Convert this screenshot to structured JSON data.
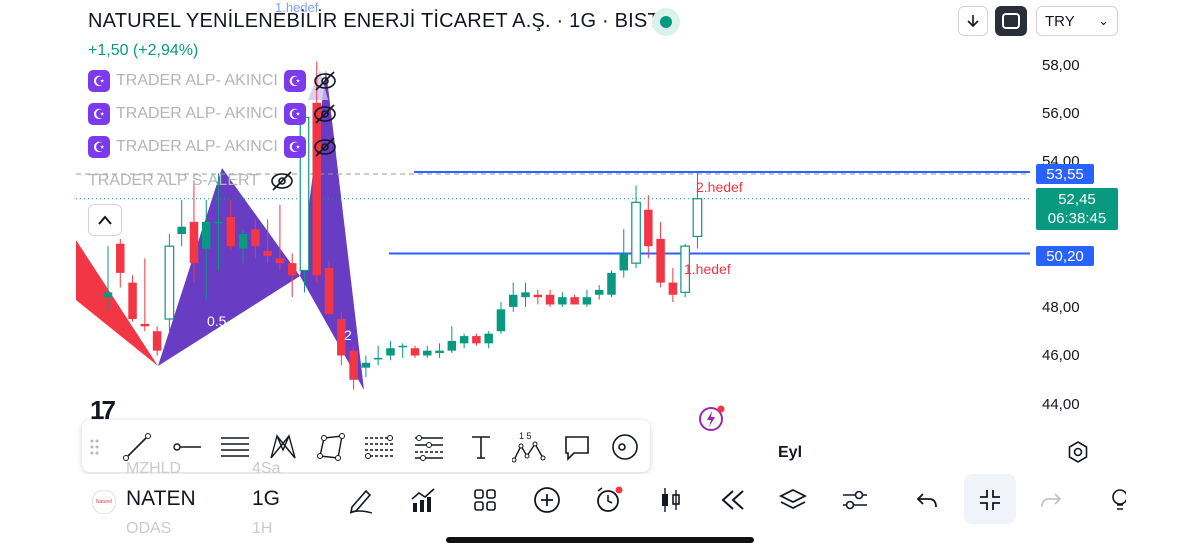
{
  "header": {
    "title": "NATUREL YENİLENEBİLİR ENERJİ TİCARET A.Ş. · 1G · BIST",
    "change": "+1,50 (+2,94%)",
    "currency": "TRY",
    "currency_arrow": "⌄"
  },
  "indicators": [
    {
      "label": "TRADER ALP- AKINCI",
      "icon": "☪"
    },
    {
      "label": "TRADER ALP- AKINCI",
      "icon": "☪"
    },
    {
      "label": "TRADER ALP- AKINCI",
      "icon": "☪"
    }
  ],
  "alert_indicator": {
    "label": "TRADER ALP S-ALERT"
  },
  "price_axis": {
    "ticks": [
      "58,00",
      "56,00",
      "54,00",
      "48,00",
      "46,00",
      "44,00"
    ],
    "label_target2": "53,55",
    "label_current": "52,45",
    "countdown": "06:38:45",
    "label_target1": "50,20"
  },
  "annotations": {
    "top_hedef": "1.hedef",
    "hedef2": "2.hedef",
    "hedef1": "1.hedef",
    "fib_a": "0.5",
    "fib_b": "2"
  },
  "time_axis": {
    "label": "Eyl"
  },
  "drawing_toolbar": {
    "label_fib": "1 5"
  },
  "bottom_bar": {
    "logo_text": "Naturel",
    "symbol": "NATEN",
    "interval": "1G",
    "ghost_above_symbol": "MZHLD",
    "ghost_above_interval": "4Sa",
    "ghost_below_symbol": "ODAS",
    "ghost_below_interval": "1H"
  },
  "colors": {
    "up": "#089981",
    "down": "#f23645",
    "level_line": "#2962ff",
    "pattern_purple": "#5b2dbf",
    "pattern_red": "#f23645"
  },
  "chart_data": {
    "type": "candlestick",
    "price_range": [
      43.0,
      59.0
    ],
    "levels": [
      {
        "name": "2.hedef",
        "price": 53.55
      },
      {
        "name": "1.hedef",
        "price": 50.2
      },
      {
        "name": "current",
        "price": 52.45
      }
    ],
    "candles": [
      {
        "o": 48.4,
        "h": 50.5,
        "l": 47.9,
        "c": 48.6
      },
      {
        "o": 50.6,
        "h": 50.8,
        "l": 48.8,
        "c": 49.4
      },
      {
        "o": 49.0,
        "h": 49.3,
        "l": 47.4,
        "c": 47.5
      },
      {
        "o": 47.3,
        "h": 50.0,
        "l": 47.0,
        "c": 47.2
      },
      {
        "o": 47.0,
        "h": 47.2,
        "l": 46.0,
        "c": 46.2
      },
      {
        "o": 47.5,
        "h": 51.0,
        "l": 47.0,
        "c": 50.5
      },
      {
        "o": 51.0,
        "h": 52.4,
        "l": 50.5,
        "c": 51.3
      },
      {
        "o": 51.5,
        "h": 53.2,
        "l": 49.0,
        "c": 49.8
      },
      {
        "o": 50.4,
        "h": 52.4,
        "l": 48.3,
        "c": 51.5
      },
      {
        "o": 51.5,
        "h": 53.5,
        "l": 49.5,
        "c": 51.5
      },
      {
        "o": 51.7,
        "h": 52.4,
        "l": 50.3,
        "c": 50.5
      },
      {
        "o": 50.4,
        "h": 51.2,
        "l": 49.8,
        "c": 51.0
      },
      {
        "o": 51.2,
        "h": 51.6,
        "l": 50.0,
        "c": 50.5
      },
      {
        "o": 50.3,
        "h": 51.6,
        "l": 49.8,
        "c": 50.1
      },
      {
        "o": 50.0,
        "h": 52.2,
        "l": 49.5,
        "c": 49.8
      },
      {
        "o": 49.8,
        "h": 50.2,
        "l": 48.4,
        "c": 49.3
      },
      {
        "o": 49.5,
        "h": 56.3,
        "l": 48.6,
        "c": 55.8
      },
      {
        "o": 56.4,
        "h": 58.1,
        "l": 49.0,
        "c": 49.3
      },
      {
        "o": 49.6,
        "h": 49.9,
        "l": 47.8,
        "c": 47.7
      },
      {
        "o": 47.5,
        "h": 47.8,
        "l": 45.6,
        "c": 46.0
      },
      {
        "o": 46.2,
        "h": 46.4,
        "l": 44.6,
        "c": 45.0
      },
      {
        "o": 45.5,
        "h": 46.0,
        "l": 45.1,
        "c": 45.7
      },
      {
        "o": 45.9,
        "h": 46.4,
        "l": 45.6,
        "c": 45.9
      },
      {
        "o": 46.0,
        "h": 46.6,
        "l": 45.8,
        "c": 46.3
      },
      {
        "o": 46.4,
        "h": 46.5,
        "l": 45.9,
        "c": 46.4
      },
      {
        "o": 46.3,
        "h": 46.4,
        "l": 45.9,
        "c": 46.0
      },
      {
        "o": 46.0,
        "h": 46.4,
        "l": 45.9,
        "c": 46.2
      },
      {
        "o": 46.1,
        "h": 46.5,
        "l": 45.9,
        "c": 46.2
      },
      {
        "o": 46.2,
        "h": 47.2,
        "l": 46.1,
        "c": 46.6
      },
      {
        "o": 46.5,
        "h": 46.9,
        "l": 46.3,
        "c": 46.8
      },
      {
        "o": 46.8,
        "h": 46.9,
        "l": 46.4,
        "c": 46.5
      },
      {
        "o": 46.5,
        "h": 47.0,
        "l": 46.3,
        "c": 46.9
      },
      {
        "o": 47.0,
        "h": 48.2,
        "l": 46.9,
        "c": 47.9
      },
      {
        "o": 48.0,
        "h": 49.0,
        "l": 47.8,
        "c": 48.5
      },
      {
        "o": 48.4,
        "h": 49.0,
        "l": 48.0,
        "c": 48.6
      },
      {
        "o": 48.5,
        "h": 48.7,
        "l": 48.1,
        "c": 48.4
      },
      {
        "o": 48.5,
        "h": 48.7,
        "l": 48.0,
        "c": 48.1
      },
      {
        "o": 48.1,
        "h": 48.6,
        "l": 48.0,
        "c": 48.4
      },
      {
        "o": 48.4,
        "h": 48.5,
        "l": 48.1,
        "c": 48.1
      },
      {
        "o": 48.1,
        "h": 48.7,
        "l": 48.0,
        "c": 48.4
      },
      {
        "o": 48.5,
        "h": 48.9,
        "l": 48.3,
        "c": 48.7
      },
      {
        "o": 48.5,
        "h": 49.5,
        "l": 48.4,
        "c": 49.4
      },
      {
        "o": 49.5,
        "h": 51.2,
        "l": 49.2,
        "c": 50.2
      },
      {
        "o": 49.8,
        "h": 53.0,
        "l": 49.6,
        "c": 52.3
      },
      {
        "o": 52.0,
        "h": 52.6,
        "l": 50.0,
        "c": 50.5
      },
      {
        "o": 50.8,
        "h": 51.5,
        "l": 48.8,
        "c": 49.0
      },
      {
        "o": 49.0,
        "h": 49.6,
        "l": 48.2,
        "c": 48.5
      },
      {
        "o": 48.6,
        "h": 50.6,
        "l": 48.4,
        "c": 50.5
      },
      {
        "o": 50.9,
        "h": 53.6,
        "l": 50.4,
        "c": 52.45
      }
    ]
  }
}
